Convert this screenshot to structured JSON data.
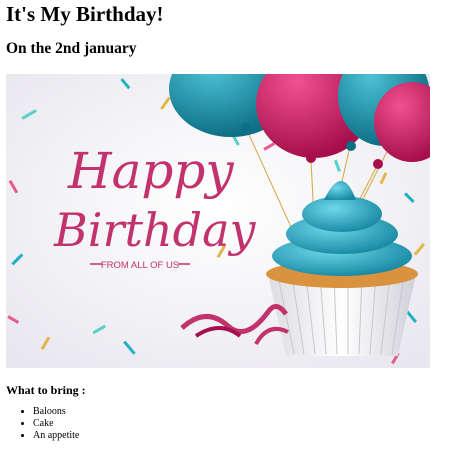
{
  "page": {
    "title": "It's My Birthday!",
    "subtitle": "On the 2nd january"
  },
  "banner": {
    "script_line1": "Happy",
    "script_line2": "Birthday",
    "tagline": "FROM ALL OF US",
    "colors": {
      "magenta": "#c2336e",
      "teal": "#1b8fa5",
      "pink_balloon": "#c8185e",
      "background": "#f1f0f4"
    }
  },
  "bring": {
    "heading": "What to bring :",
    "items": [
      "Baloons",
      "Cake",
      "An appetite"
    ]
  }
}
